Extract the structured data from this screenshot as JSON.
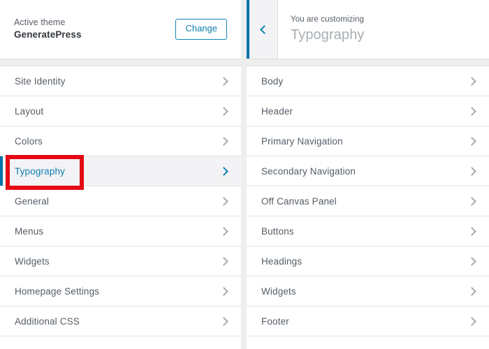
{
  "left_panel": {
    "header": {
      "active_theme_label": "Active theme",
      "theme_name": "GeneratePress",
      "change_button": "Change"
    },
    "items": [
      {
        "label": "Site Identity",
        "active": false
      },
      {
        "label": "Layout",
        "active": false
      },
      {
        "label": "Colors",
        "active": false
      },
      {
        "label": "Typography",
        "active": true
      },
      {
        "label": "General",
        "active": false
      },
      {
        "label": "Menus",
        "active": false
      },
      {
        "label": "Widgets",
        "active": false
      },
      {
        "label": "Homepage Settings",
        "active": false
      },
      {
        "label": "Additional CSS",
        "active": false
      }
    ]
  },
  "right_panel": {
    "header": {
      "back_icon": "chevron-left-icon",
      "customizing_label": "You are customizing",
      "section_title": "Typography"
    },
    "items": [
      {
        "label": "Body"
      },
      {
        "label": "Header"
      },
      {
        "label": "Primary Navigation"
      },
      {
        "label": "Secondary Navigation"
      },
      {
        "label": "Off Canvas Panel"
      },
      {
        "label": "Buttons"
      },
      {
        "label": "Headings"
      },
      {
        "label": "Widgets"
      },
      {
        "label": "Footer"
      }
    ]
  },
  "annotation": {
    "target": "Typography",
    "color": "#e50914"
  },
  "colors": {
    "accent_blue": "#0073aa",
    "link_blue": "#0e7fae",
    "text_gray": "#555d66",
    "title_gray": "#a8aeb3",
    "chevron_gray": "#a6abb0",
    "row_border": "#e3e3e3",
    "active_row_bg": "#f3f3f5",
    "band_gray": "#eeeeee",
    "annotation_red": "#e50914"
  }
}
